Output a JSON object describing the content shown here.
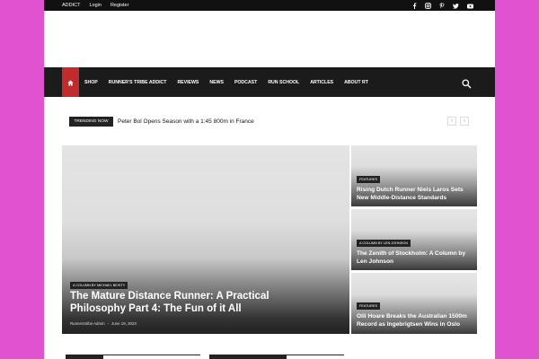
{
  "topbar": {
    "links": [
      "ADDICT",
      "Login",
      "Register"
    ],
    "social": [
      "facebook-icon",
      "instagram-icon",
      "pinterest-icon",
      "twitter-icon",
      "youtube-icon"
    ]
  },
  "nav": {
    "items": [
      "SHOP",
      "RUNNER'S TRIBE ADDICT",
      "REVIEWS",
      "NEWS",
      "PODCAST",
      "RUN SCHOOL",
      "ARTICLES",
      "ABOUT RT"
    ]
  },
  "trending": {
    "label": "TRENDING NOW",
    "headline": "Peter Bol Opens Season with a 1:45 800m in France",
    "prev": "‹",
    "next": "›"
  },
  "featured": {
    "category": "A COLUMN BY MICHAEL BEISTY",
    "title": "The Mature Distance Runner: A Practical Philosophy Part 4: The Fun of it All",
    "author": "Runnerstribe Admin",
    "separator": "-",
    "date": "June 19, 2023"
  },
  "side_cards": [
    {
      "category": "FEATURES",
      "title": "Rising Dutch Runner Niels Laros Sets New Middle-Distance Standards"
    },
    {
      "category": "A COLUMN BY LEN JOHNSON",
      "title": "The Zenith of Stockholm: A Column by Len Johnson"
    },
    {
      "category": "FEATURES",
      "title": "Olli Hoare Breaks the Australian 1500m Record as Ingebrigtsen Wins in Oslo"
    }
  ],
  "colors": {
    "background": "#e052d0",
    "accent": "#c22b2b",
    "nav": "#1b1b1b"
  }
}
